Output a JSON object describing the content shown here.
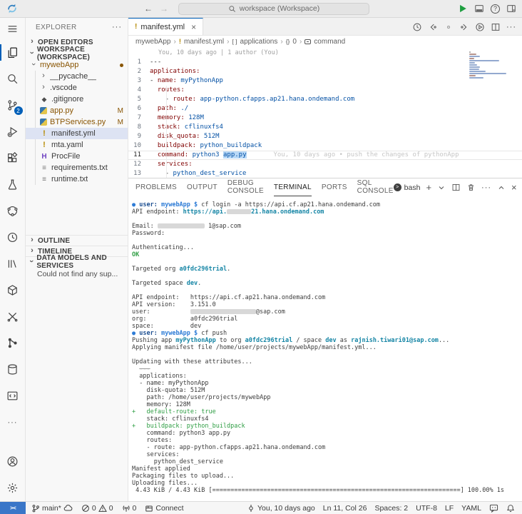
{
  "title_bar": {
    "search_placeholder": "workspace (Workspace)"
  },
  "activity_bar": {
    "badge": "2",
    "items": [
      "menu",
      "explorer",
      "search",
      "source-control",
      "run-debug",
      "extensions",
      "testing",
      "share",
      "run-profile",
      "library",
      "deploy",
      "tools",
      "commits",
      "database",
      "code-check",
      "more",
      "account",
      "settings"
    ]
  },
  "explorer": {
    "title": "EXPLORER",
    "open_editors_label": "OPEN EDITORS",
    "workspace_label": "WORKSPACE (WORKSPACE)",
    "tree": [
      {
        "label": "mywebApp",
        "chevron": "down",
        "depth": 0,
        "color": "modified",
        "badge_dot": true
      },
      {
        "label": "__pycache__",
        "chevron": "right",
        "depth": 1
      },
      {
        "label": ".vscode",
        "chevron": "right",
        "depth": 1
      },
      {
        "label": ".gitignore",
        "icon": "git",
        "depth": 1
      },
      {
        "label": "app.py",
        "icon": "python",
        "depth": 1,
        "color": "modified",
        "badge": "M"
      },
      {
        "label": "BTPServices.py",
        "icon": "python",
        "depth": 1,
        "color": "modified",
        "badge": "M"
      },
      {
        "label": "manifest.yml",
        "icon": "yaml",
        "depth": 1,
        "selected": true
      },
      {
        "label": "mta.yaml",
        "icon": "yaml",
        "depth": 1
      },
      {
        "label": "ProcFile",
        "icon": "proc",
        "depth": 1
      },
      {
        "label": "requirements.txt",
        "icon": "txt",
        "depth": 1
      },
      {
        "label": "runtime.txt",
        "icon": "txt",
        "depth": 1
      }
    ],
    "sections": {
      "outline": "OUTLINE",
      "timeline": "TIMELINE",
      "dms": "DATA MODELS AND SERVICES",
      "dms_body": "Could not find any sup..."
    }
  },
  "editor": {
    "tab": {
      "label": "manifest.yml"
    },
    "breadcrumb": [
      {
        "label": "mywebApp"
      },
      {
        "label": "manifest.yml",
        "icon": "warn"
      },
      {
        "label": "applications",
        "icon": "array"
      },
      {
        "label": "0",
        "icon": "object"
      },
      {
        "label": "command",
        "icon": "field"
      }
    ],
    "blame": "You, 10 days ago | 1 author (You)",
    "lines": [
      {
        "n": 1,
        "s": [
          {
            "t": "---",
            "c": "d"
          }
        ]
      },
      {
        "n": 2,
        "s": [
          {
            "t": "applications:",
            "c": "k"
          }
        ]
      },
      {
        "n": 3,
        "s": [
          {
            "t": "- ",
            "c": "d"
          },
          {
            "t": "name:",
            "c": "k"
          },
          {
            "t": " ",
            "c": "d"
          },
          {
            "t": "myPythonApp",
            "c": "v"
          }
        ]
      },
      {
        "n": 4,
        "s": [
          {
            "t": "  ",
            "c": "d"
          },
          {
            "t": "routes:",
            "c": "k"
          }
        ]
      },
      {
        "n": 5,
        "s": [
          {
            "t": "    - ",
            "c": "d"
          },
          {
            "t": "route:",
            "c": "k"
          },
          {
            "t": " ",
            "c": "d"
          },
          {
            "t": "app-python.cfapps.ap21.hana.ondemand.com",
            "c": "v"
          }
        ]
      },
      {
        "n": 6,
        "s": [
          {
            "t": "  ",
            "c": "d"
          },
          {
            "t": "path:",
            "c": "k"
          },
          {
            "t": " ",
            "c": "d"
          },
          {
            "t": "./",
            "c": "v"
          }
        ]
      },
      {
        "n": 7,
        "s": [
          {
            "t": "  ",
            "c": "d"
          },
          {
            "t": "memory:",
            "c": "k"
          },
          {
            "t": " ",
            "c": "d"
          },
          {
            "t": "128M",
            "c": "v"
          }
        ]
      },
      {
        "n": 8,
        "s": [
          {
            "t": "  ",
            "c": "d"
          },
          {
            "t": "stack:",
            "c": "k"
          },
          {
            "t": " ",
            "c": "d"
          },
          {
            "t": "cflinuxfs4",
            "c": "v"
          }
        ]
      },
      {
        "n": 9,
        "s": [
          {
            "t": "  ",
            "c": "d"
          },
          {
            "t": "disk_quota:",
            "c": "k"
          },
          {
            "t": " ",
            "c": "d"
          },
          {
            "t": "512M",
            "c": "v"
          }
        ]
      },
      {
        "n": 10,
        "s": [
          {
            "t": "  ",
            "c": "d"
          },
          {
            "t": "buildpack:",
            "c": "k"
          },
          {
            "t": " ",
            "c": "d"
          },
          {
            "t": "python_buildpack",
            "c": "v"
          }
        ]
      },
      {
        "n": 11,
        "cur": true,
        "s": [
          {
            "t": "  ",
            "c": "d"
          },
          {
            "t": "command:",
            "c": "k"
          },
          {
            "t": " ",
            "c": "d"
          },
          {
            "t": "python3 ",
            "c": "v"
          },
          {
            "t": "app.py",
            "c": "vs"
          },
          {
            "t": "       ",
            "c": "d"
          },
          {
            "t": "You, 10 days ago • push the changes of pythonApp",
            "c": "g"
          }
        ]
      },
      {
        "n": 12,
        "s": [
          {
            "t": "  ",
            "c": "d"
          },
          {
            "t": "services:",
            "c": "k"
          }
        ]
      },
      {
        "n": 13,
        "s": [
          {
            "t": "    - ",
            "c": "d"
          },
          {
            "t": "python_dest_service",
            "c": "v"
          }
        ]
      }
    ]
  },
  "panel": {
    "tabs": [
      "PROBLEMS",
      "OUTPUT",
      "DEBUG CONSOLE",
      "TERMINAL",
      "PORTS",
      "SQL CONSOLE"
    ],
    "active_tab": "TERMINAL",
    "shell_label": "bash",
    "terminal": [
      [
        {
          "t": "● ",
          "c": "dot"
        },
        {
          "t": "user: ",
          "c": "nb"
        },
        {
          "t": "mywebApp ",
          "c": "cb"
        },
        {
          "t": "$ ",
          "c": "cb"
        },
        {
          "t": "cf login -a https://api.cf.ap21.hana.ondemand.com"
        }
      ],
      [
        {
          "t": "API endpoint: "
        },
        {
          "t": "https://api.",
          "c": "tb"
        },
        {
          "r": 34
        },
        {
          "t": "21.hana.ondemand.com",
          "c": "tb"
        }
      ],
      [],
      [
        {
          "t": "Email: "
        },
        {
          "r": 66
        },
        {
          "t": " 1@sap.com"
        }
      ],
      [
        {
          "t": "Password:"
        }
      ],
      [],
      [
        {
          "t": "Authenticating..."
        }
      ],
      [
        {
          "t": "OK",
          "c": "gb"
        }
      ],
      [],
      [
        {
          "t": "Targeted org "
        },
        {
          "t": "a0fdc296trial",
          "c": "tb"
        },
        {
          "t": "."
        }
      ],
      [],
      [
        {
          "t": "Targeted space "
        },
        {
          "t": "dev",
          "c": "tb"
        },
        {
          "t": "."
        }
      ],
      [],
      [
        {
          "t": "API endpoint:   https://api.cf.ap21.hana.ondemand.com"
        }
      ],
      [
        {
          "t": "API version:    3.151.0"
        }
      ],
      [
        {
          "t": "user:           "
        },
        {
          "r": 92
        },
        {
          "t": "@sap.com"
        }
      ],
      [
        {
          "t": "org:            a0fdc296trial"
        }
      ],
      [
        {
          "t": "space:          dev"
        }
      ],
      [
        {
          "t": "● ",
          "c": "dot"
        },
        {
          "t": "user: ",
          "c": "nb"
        },
        {
          "t": "mywebApp ",
          "c": "cb"
        },
        {
          "t": "$ ",
          "c": "cb"
        },
        {
          "t": "cf push"
        }
      ],
      [
        {
          "t": "Pushing app "
        },
        {
          "t": "myPythonApp",
          "c": "tb"
        },
        {
          "t": " to org "
        },
        {
          "t": "a0fdc296trial",
          "c": "tb"
        },
        {
          "t": " / space "
        },
        {
          "t": "dev",
          "c": "tb"
        },
        {
          "t": " as "
        },
        {
          "t": "rajnish.tiwari01@sap.com",
          "c": "tb"
        },
        {
          "t": "..."
        }
      ],
      [
        {
          "t": "Applying manifest file /home/user/projects/mywebApp/manifest.yml..."
        }
      ],
      [],
      [
        {
          "t": "Updating with these attributes..."
        }
      ],
      [
        {
          "t": "  "
        },
        {
          "t": "---",
          "c": "st"
        }
      ],
      [
        {
          "t": "  applications:"
        }
      ],
      [
        {
          "t": "  - name: myPythonApp"
        }
      ],
      [
        {
          "t": "    disk-quota: 512M"
        }
      ],
      [
        {
          "t": "    path: /home/user/projects/mywebApp"
        }
      ],
      [
        {
          "t": "    memory: 128M"
        }
      ],
      [
        {
          "t": "+   default-route: true",
          "c": "gn"
        }
      ],
      [
        {
          "t": "    stack: cflinuxfs4"
        }
      ],
      [
        {
          "t": "+   buildpack: python_buildpack",
          "c": "gn"
        }
      ],
      [
        {
          "t": "    command: python3 app.py"
        }
      ],
      [
        {
          "t": "    routes:"
        }
      ],
      [
        {
          "t": "    - route: app-python.cfapps.ap21.hana.ondemand.com"
        }
      ],
      [
        {
          "t": "    services:"
        }
      ],
      [
        {
          "t": "      python_dest_service"
        }
      ],
      [
        {
          "t": "Manifest applied"
        }
      ],
      [
        {
          "t": "Packaging files to upload..."
        }
      ],
      [
        {
          "t": "Uploading files..."
        }
      ],
      [
        {
          "t": " 4.43 KiB / 4.43 KiB [====================================================================] 100.00% 1s"
        }
      ]
    ]
  },
  "status_bar": {
    "branch": "main*",
    "errors": "0",
    "warnings": "0",
    "ports": "0",
    "connect_label": "Connect",
    "author": "You, 10 days ago",
    "cursor": "Ln 11, Col 26",
    "indent": "Spaces: 2",
    "encoding": "UTF-8",
    "eol": "LF",
    "language": "YAML"
  }
}
